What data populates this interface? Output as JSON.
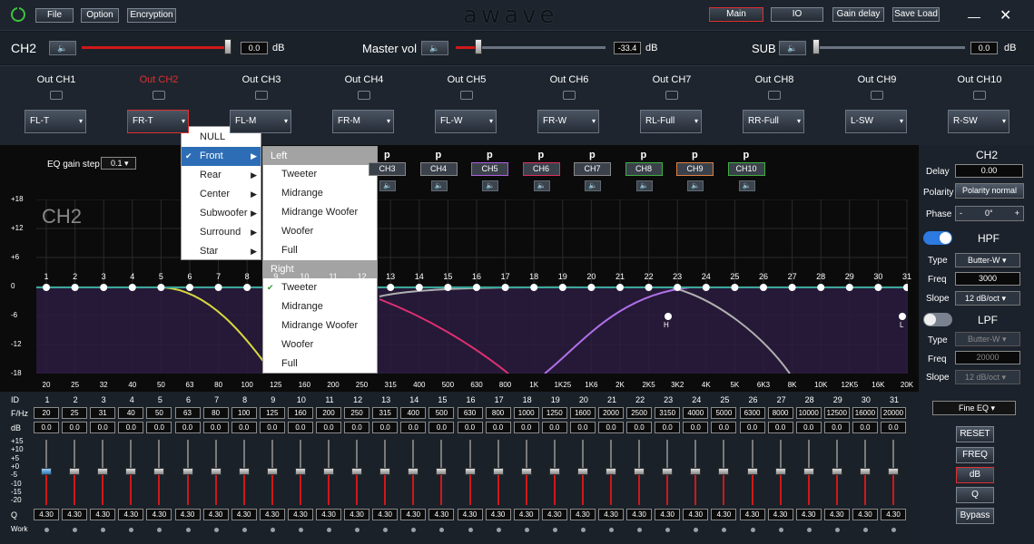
{
  "titlebar": {
    "logo": "awave",
    "file": "File",
    "option": "Option",
    "encryption": "Encryption",
    "main": "Main",
    "io": "IO",
    "gain_delay": "Gain delay",
    "save_load": "Save Load",
    "minimize": "—",
    "close": "✕"
  },
  "volume": {
    "ch_label": "CH2",
    "ch_value": "0.0",
    "ch_unit": "dB",
    "master_label": "Master vol",
    "master_value": "-33.4",
    "master_unit": "dB",
    "sub_label": "SUB",
    "sub_value": "0.0",
    "sub_unit": "dB"
  },
  "outputs": [
    {
      "label": "Out CH1",
      "sel": "FL-T"
    },
    {
      "label": "Out CH2",
      "sel": "FR-T"
    },
    {
      "label": "Out CH3",
      "sel": "FL-M"
    },
    {
      "label": "Out CH4",
      "sel": "FR-M"
    },
    {
      "label": "Out CH5",
      "sel": "FL-W"
    },
    {
      "label": "Out CH6",
      "sel": "FR-W"
    },
    {
      "label": "Out CH7",
      "sel": "RL-Full"
    },
    {
      "label": "Out CH8",
      "sel": "RR-Full"
    },
    {
      "label": "Out CH9",
      "sel": "L-SW"
    },
    {
      "label": "Out CH10",
      "sel": "R-SW"
    }
  ],
  "eq_gain_step": {
    "label": "EQ gain step",
    "value": "0.1"
  },
  "channel_checks": [
    {
      "p": "p",
      "label": "CH3"
    },
    {
      "p": "p",
      "label": "CH4"
    },
    {
      "p": "p",
      "label": "CH5"
    },
    {
      "p": "p",
      "label": "CH6"
    },
    {
      "p": "p",
      "label": "CH7"
    },
    {
      "p": "p",
      "label": "CH8"
    },
    {
      "p": "p",
      "label": "CH9"
    },
    {
      "p": "p",
      "label": "CH10"
    }
  ],
  "graph": {
    "channel": "CH2",
    "y_labels": [
      "+18",
      "+12",
      "+6",
      "0",
      "-6",
      "-12",
      "-18"
    ],
    "x_labels": [
      "20",
      "25",
      "32",
      "40",
      "50",
      "63",
      "80",
      "100",
      "125",
      "160",
      "200",
      "250",
      "315",
      "400",
      "500",
      "630",
      "800",
      "1K",
      "1K25",
      "1K6",
      "2K",
      "2K5",
      "3K2",
      "4K",
      "5K",
      "6K3",
      "8K",
      "10K",
      "12K5",
      "16K",
      "20K"
    ],
    "points": [
      "1",
      "2",
      "3",
      "4",
      "5",
      "6",
      "7",
      "8",
      "9",
      "10",
      "11",
      "12",
      "13",
      "14",
      "15",
      "16",
      "17",
      "18",
      "19",
      "20",
      "21",
      "22",
      "23",
      "24",
      "25",
      "26",
      "27",
      "28",
      "29",
      "30",
      "31"
    ],
    "hpf_marker": "H",
    "lpf_marker": "L"
  },
  "menu_main": [
    "NULL",
    "Front",
    "Rear",
    "Center",
    "Subwoofer",
    "Surround",
    "Star"
  ],
  "menu_arrow": "▶",
  "menu_check": "✔",
  "submenu": {
    "left_head": "Left",
    "left": [
      "Tweeter",
      "Midrange",
      "Midrange Woofer",
      "Woofer",
      "Full"
    ],
    "right_head": "Right",
    "right": [
      "Tweeter",
      "Midrange",
      "Midrange Woofer",
      "Woofer",
      "Full"
    ]
  },
  "right_panel": {
    "title": "CH2",
    "delay_label": "Delay",
    "delay_value": "0.00",
    "polarity_label": "Polarity",
    "polarity_value": "Polarity normal",
    "phase_label": "Phase",
    "phase_minus": "-",
    "phase_value": "0°",
    "phase_plus": "+",
    "hpf": "HPF",
    "hpf_type_label": "Type",
    "hpf_type": "Butter-W",
    "hpf_freq_label": "Freq",
    "hpf_freq": "3000",
    "hpf_slope_label": "Slope",
    "hpf_slope": "12 dB/oct",
    "lpf": "LPF",
    "lpf_type_label": "Type",
    "lpf_type": "Butter-W",
    "lpf_freq_label": "Freq",
    "lpf_freq": "20000",
    "lpf_slope_label": "Slope",
    "lpf_slope": "12 dB/oct"
  },
  "eq_table": {
    "id_label": "ID",
    "fhz_label": "F/Hz",
    "db_label": "dB",
    "q_label": "Q",
    "work_label": "Work",
    "freqs": [
      "20",
      "25",
      "31",
      "40",
      "50",
      "63",
      "80",
      "100",
      "125",
      "160",
      "200",
      "250",
      "315",
      "400",
      "500",
      "630",
      "800",
      "1000",
      "1250",
      "1600",
      "2000",
      "2500",
      "3150",
      "4000",
      "5000",
      "6300",
      "8000",
      "10000",
      "12500",
      "16000",
      "20000"
    ],
    "db": "0.0",
    "q": "4.30",
    "gain_scale": [
      "+15",
      "+10",
      "+5",
      "+0",
      "-5",
      "-10",
      "-15",
      "-20"
    ]
  },
  "eq_mode": "Fine EQ",
  "side_buttons": {
    "reset": "RESET",
    "freq": "FREQ",
    "db": "dB",
    "q": "Q",
    "bypass": "Bypass"
  }
}
